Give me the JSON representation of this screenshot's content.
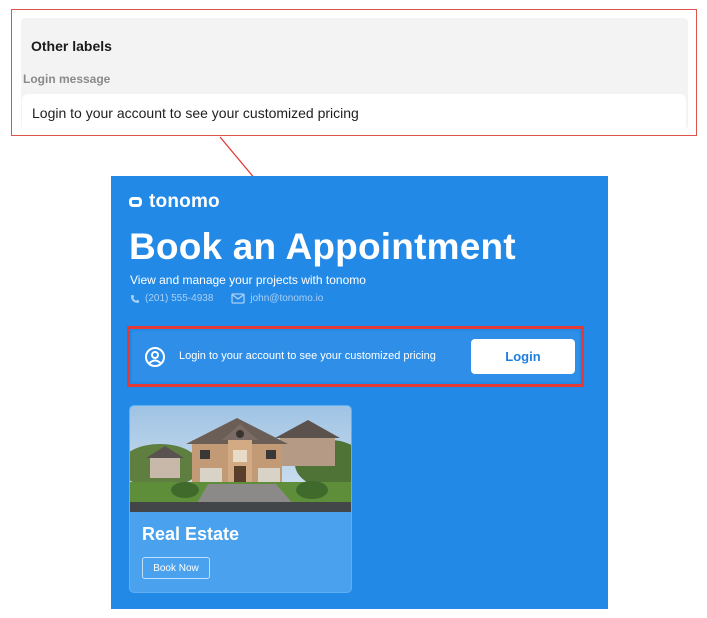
{
  "settings_panel": {
    "title": "Other labels",
    "field_label": "Login message",
    "field_value": "Login to your account to see your customized pricing"
  },
  "widget": {
    "logo_text": "tonomo",
    "title": "Book an Appointment",
    "subtitle": "View and manage your projects with tonomo",
    "phone": "(201) 555-4938",
    "email": "john@tonomo.io",
    "login_message": "Login to your account to see your customized pricing",
    "login_button": "Login",
    "card": {
      "title": "Real Estate",
      "button": "Book Now"
    }
  },
  "colors": {
    "widget_background": "#2389e6",
    "highlight_border": "#e53935",
    "button_text": "#1f7fe0"
  },
  "icons": [
    "phone-icon",
    "mail-icon",
    "user-circle-icon",
    "logo-icon"
  ]
}
